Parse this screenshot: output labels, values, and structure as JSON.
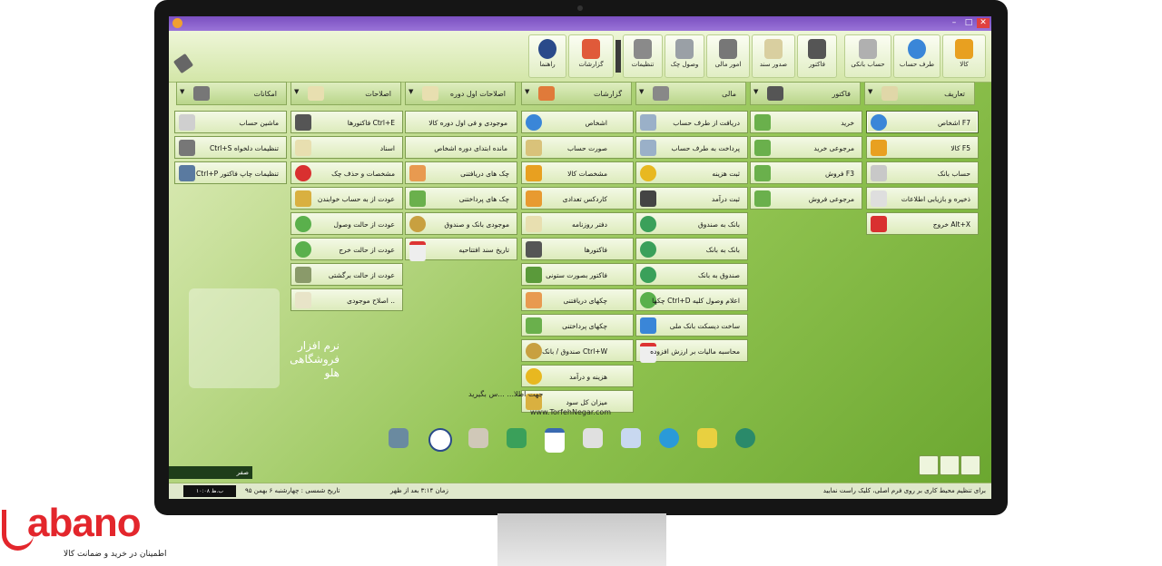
{
  "toolbar": {
    "buttons": [
      {
        "label": "کالا",
        "color": "#e8a020"
      },
      {
        "label": "طرف حساب",
        "color": "#3a86d8"
      },
      {
        "label": "حساب بانکی",
        "color": "#b0b0b0"
      },
      {
        "label": "فاکتور",
        "color": "#555555"
      },
      {
        "label": "صدور سند",
        "color": "#d9cfa0"
      },
      {
        "label": "امور مالی",
        "color": "#777777"
      },
      {
        "label": "وصول چک",
        "color": "#9aa0a6"
      },
      {
        "label": "تنظیمات",
        "color": "#8a8a8a"
      },
      {
        "label": "گزارشات",
        "color": "#e05a3a"
      },
      {
        "label": "راهنما",
        "color": "#2a4a8a"
      }
    ]
  },
  "headers": [
    {
      "label": "تعاریف",
      "icon": "pencil-icon"
    },
    {
      "label": "فاکتور",
      "icon": "invoice-icon"
    },
    {
      "label": "مالی",
      "icon": "money-icon"
    },
    {
      "label": "گزارشات",
      "icon": "report-icon"
    },
    {
      "label": "اصلاحات اول دوره",
      "icon": "edit-icon"
    },
    {
      "label": "اصلاحات",
      "icon": "edit2-icon"
    },
    {
      "label": "امکانات",
      "icon": "tools-icon"
    }
  ],
  "menus": {
    "definitions": [
      "اشخاص F7",
      "کالا F5",
      "حساب بانک",
      "ذخیره و بازیابی اطلاعات",
      "خروج Alt+X"
    ],
    "invoice": [
      "خرید",
      "مرجوعی خرید",
      "فروش F3",
      "مرجوعی فروش"
    ],
    "finance": [
      "دریافت از طرف حساب",
      "پرداخت به طرف حساب",
      "ثبت هزینه",
      "ثبت درآمد",
      "بانک به صندوق",
      "بانک به بانک",
      "صندوق به بانک",
      "چکها Ctrl+D اعلام وصول کلیه",
      "ساخت دیسکت بانک ملی",
      "محاسبه مالیات بر ارزش افزوده"
    ],
    "reports": [
      "اشخاص",
      "صورت حساب",
      "مشخصات کالا",
      "کاردکس تعدادی",
      "دفتر روزنامه",
      "فاکتورها",
      "فاکتور بصورت ستونی",
      "چکهای دریافتنی",
      "چکهای پرداختنی",
      "صندوق / بانک Ctrl+W",
      "هزینه و درآمد",
      "میزان کل سود"
    ],
    "opening": [
      "موجودی و فی اول دوره کالا",
      "مانده ابتدای دوره اشخاص",
      "چک های دریافتنی",
      "چک های پرداختنی",
      "موجودی بانک و صندوق",
      "تاریخ سند افتتاحیه"
    ],
    "corrections": [
      "فاکتورها Ctrl+E",
      "اسناد",
      "مشخصات و حذف چک",
      "عودت از به حساب خوابندن",
      "عودت از حالت وصول",
      "عودت از حالت خرج",
      "عودت از حالت برگشتی",
      "اصلاح موجودی .."
    ],
    "facilities": [
      "ماشین حساب",
      "Ctrl+S تنظیمات دلخواه",
      "Ctrl+P تنظیمات چاپ فاکتور"
    ]
  },
  "logo_text": "نرم افزار فروشگاهی هلو",
  "contact_text": "جهت اطلا...                    ...س بگیرید",
  "site_url": "www.TorfehNegar.com",
  "progress_label": "صفر",
  "status": {
    "right_text": "برای تنظیم محیط کاری بر روی فرم اصلی، کلیک راست نمایید",
    "time": "زمان ۳:۱۴ بعد از ظهر",
    "date": "تاریخ شمسی : چهارشنبه ۶ بهمن ۹۵",
    "black_box": "۱۰:۰۸ ب.ظ"
  },
  "brand": {
    "name": "abano",
    "tagline": "اطمینان در خرید و ضمانت کالا"
  }
}
